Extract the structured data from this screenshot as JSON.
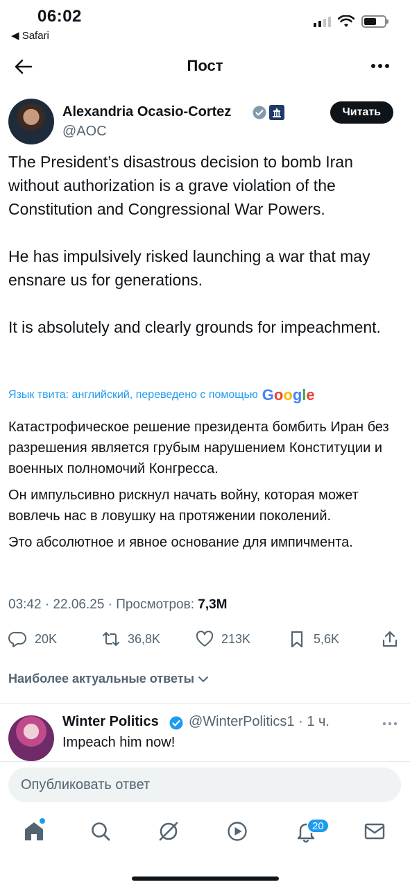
{
  "status_bar": {
    "time": "06:02",
    "back_app": "◀ Safari"
  },
  "header": {
    "title": "Пост"
  },
  "author": {
    "name": "Alexandria Ocasio-Cortez",
    "handle": "@AOC",
    "follow_label": "Читать"
  },
  "tweet": {
    "paragraphs": [
      "The President’s disastrous decision to bomb Iran without authorization is a grave violation of the Constitution and Congressional War Powers.",
      "He has impulsively risked launching a war that may ensnare us for generations.",
      "It is absolutely and clearly grounds for impeachment."
    ],
    "translate_note": "Язык твита: английский, переведено с помощью",
    "translate_brand": "Google",
    "translated_paragraphs": [
      "Катастрофическое решение президента бомбить Иран без разрешения является грубым нарушением Конституции и военных полномочий Конгресса.",
      "Он импульсивно рискнул начать войну, которая может вовлечь нас в ловушку на протяжении поколений.",
      "Это абсолютное и явное основание для импичмента."
    ],
    "meta_prefix": "03:42 · 22.06.25 · Просмотров: ",
    "views": "7,3M"
  },
  "actions": {
    "replies": "20K",
    "reposts": "36,8K",
    "likes": "213K",
    "bookmarks": "5,6K"
  },
  "replies_sort_label": "Наиболее актуальные ответы",
  "reply": {
    "name": "Winter Politics",
    "handle_time": "@WinterPolitics1 · 1 ч.",
    "text": "Impeach him now!"
  },
  "reply_input": {
    "placeholder": "Опубликовать ответ"
  },
  "tabbar": {
    "notifications_count": "20"
  },
  "colors": {
    "accent": "#1d9bf0",
    "text": "#0f1419",
    "muted": "#536471"
  }
}
